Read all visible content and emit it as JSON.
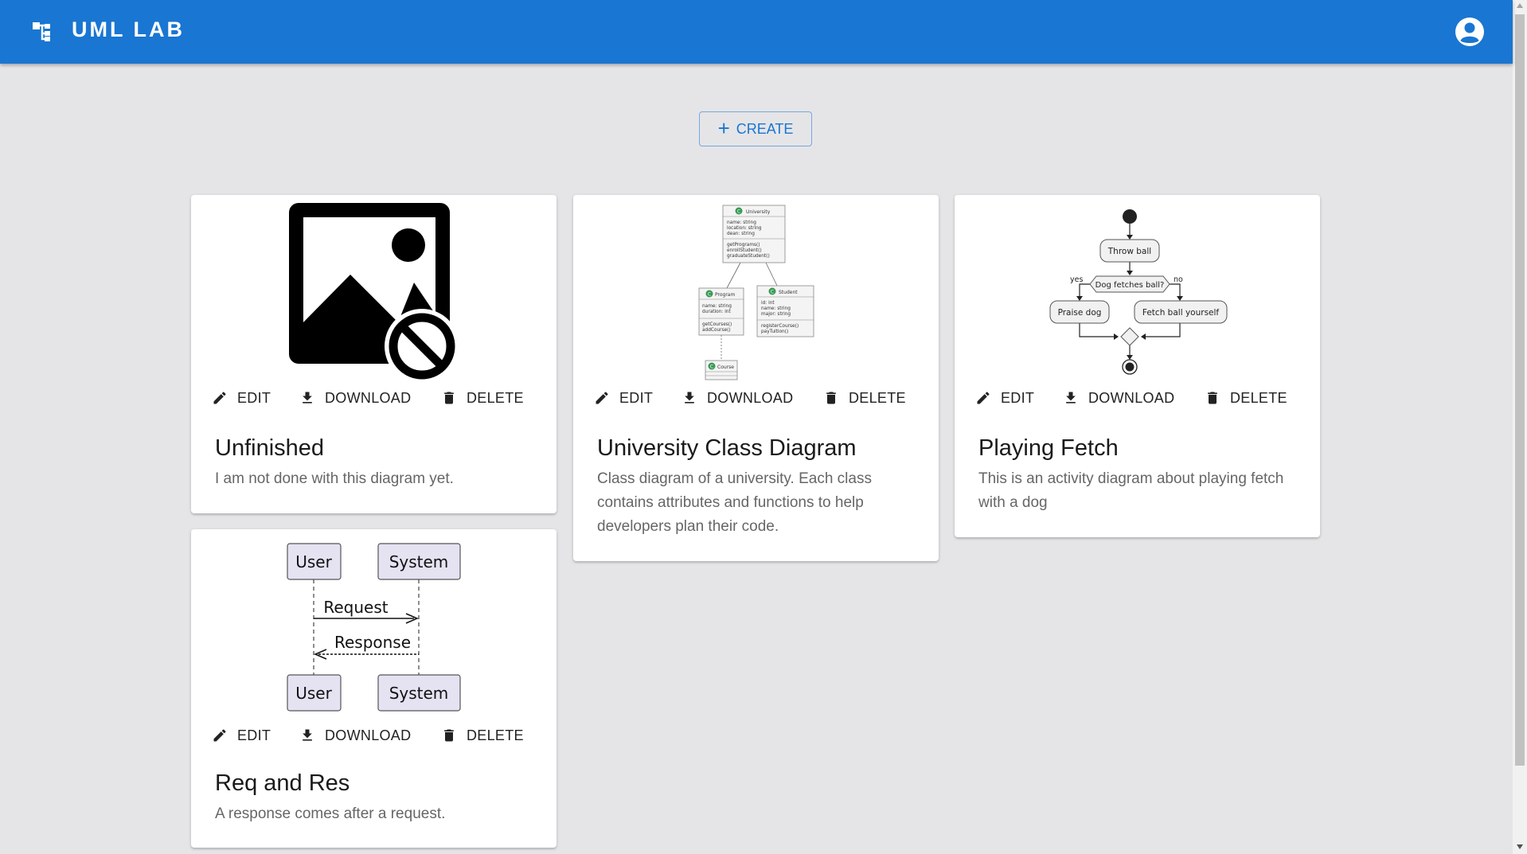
{
  "app": {
    "title": "UML LAB",
    "logo_icon": "schema-icon",
    "account_icon": "account-circle-icon"
  },
  "create_button": {
    "label": "CREATE",
    "icon": "plus-icon"
  },
  "actions": {
    "edit": "EDIT",
    "download": "DOWNLOAD",
    "delete": "DELETE"
  },
  "cards": [
    {
      "title": "Unfinished",
      "description": "I am not done with this diagram yet.",
      "thumbnail": "image-not-supported-icon"
    },
    {
      "title": "University Class Diagram",
      "description": "Class diagram of a university. Each class contains attributes and functions to help developers plan their code.",
      "thumbnail": "class-diagram",
      "diagram": {
        "classes": [
          {
            "name": "University",
            "attributes": [
              "name: string",
              "location: string",
              "dean: string"
            ],
            "methods": [
              "getPrograms()",
              "enrollStudent()",
              "graduateStudent()"
            ]
          },
          {
            "name": "Program",
            "attributes": [
              "name: string",
              "duration: int"
            ],
            "methods": [
              "getCourses()",
              "addCourse()"
            ]
          },
          {
            "name": "Student",
            "attributes": [
              "id: int",
              "name: string",
              "major: string"
            ],
            "methods": [
              "registerCourse()",
              "payTuition()"
            ]
          },
          {
            "name": "Course",
            "attributes": [],
            "methods": []
          }
        ],
        "class_marker": "C"
      }
    },
    {
      "title": "Playing Fetch",
      "description": "This is an activity diagram about playing fetch with a dog",
      "thumbnail": "activity-diagram",
      "diagram": {
        "action_start": "Throw ball",
        "decision": "Dog fetches ball?",
        "yes_label": "yes",
        "no_label": "no",
        "yes_action": "Praise dog",
        "no_action": "Fetch ball yourself"
      }
    },
    {
      "title": "Req and Res",
      "description": "A response comes after a request.",
      "thumbnail": "sequence-diagram",
      "diagram": {
        "participants": [
          "User",
          "System"
        ],
        "messages": [
          "Request",
          "Response"
        ]
      }
    }
  ]
}
